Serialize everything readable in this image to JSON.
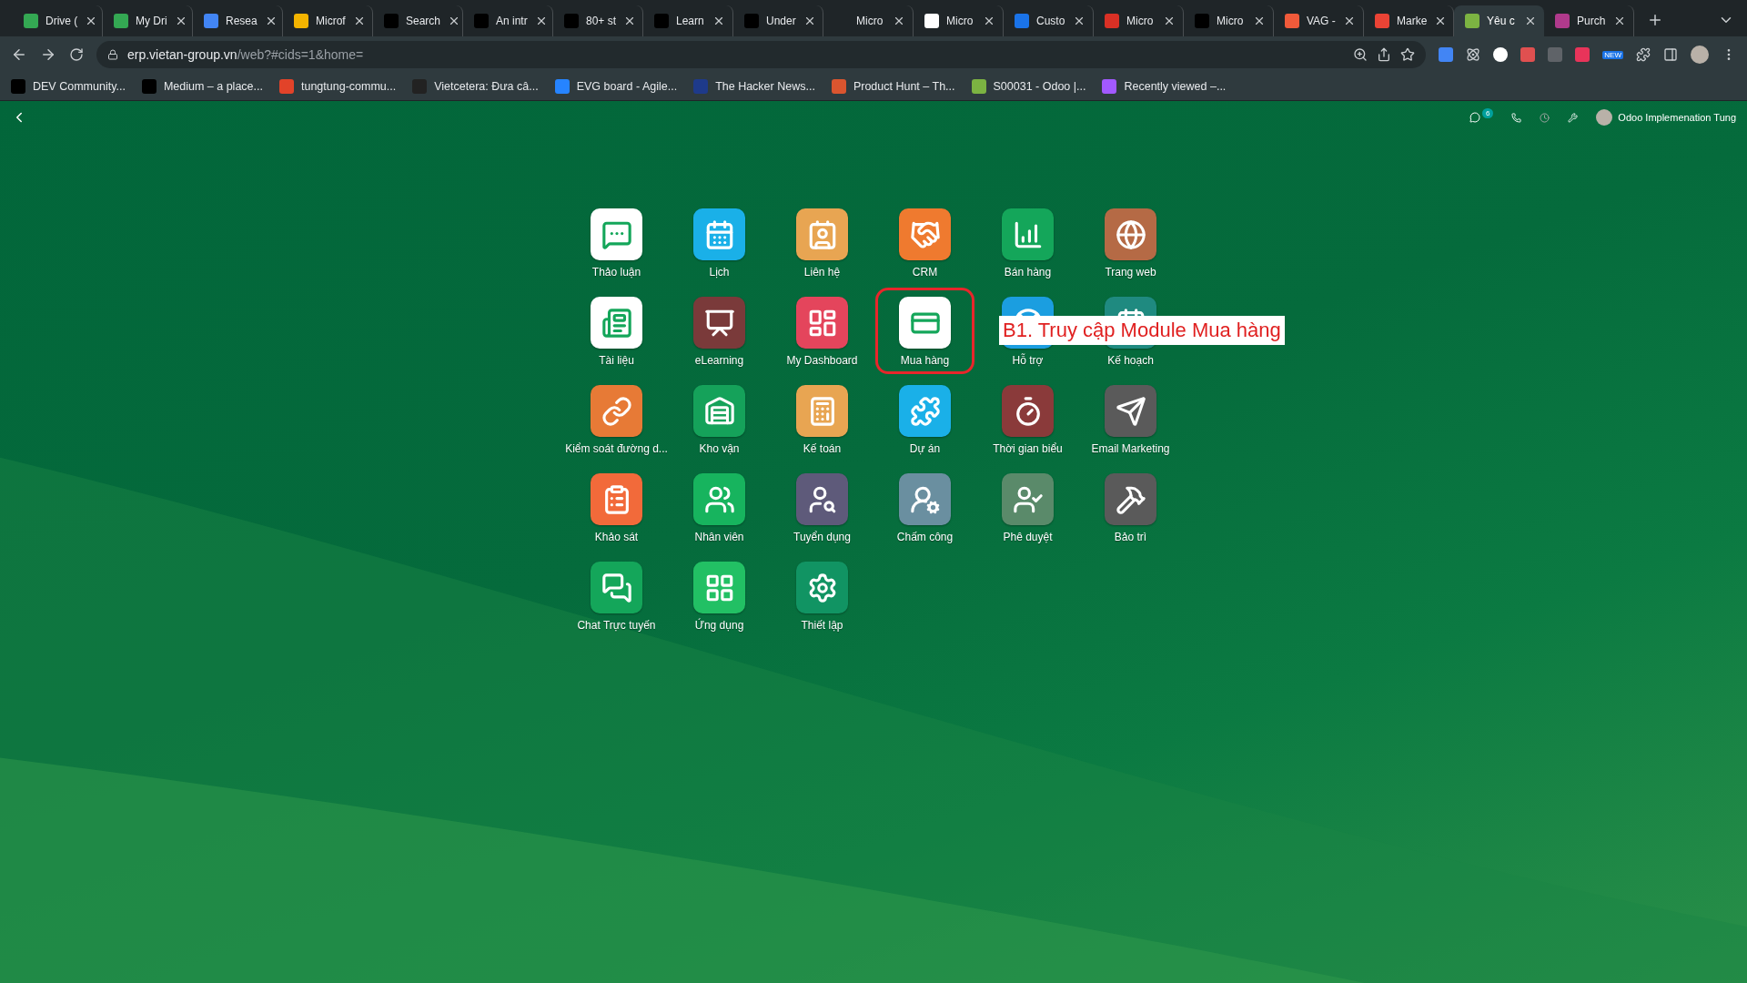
{
  "browser": {
    "tabs": [
      {
        "title": "Drive (",
        "selected": false,
        "color": "#34a853"
      },
      {
        "title": "My Dri",
        "selected": false,
        "color": "#34a853"
      },
      {
        "title": "Resea",
        "selected": false,
        "color": "#4285f4"
      },
      {
        "title": "Microf",
        "selected": false,
        "color": "#f4b400"
      },
      {
        "title": "Search",
        "selected": false,
        "color": "#000000"
      },
      {
        "title": "An intr",
        "selected": false,
        "color": "#000000"
      },
      {
        "title": "80+ st",
        "selected": false,
        "color": "#000000"
      },
      {
        "title": "Learn",
        "selected": false,
        "color": "#000000"
      },
      {
        "title": "Under",
        "selected": false,
        "color": "#000000"
      },
      {
        "title": "Micro",
        "selected": false
      },
      {
        "title": "Micro",
        "selected": false,
        "color": "#ffffff"
      },
      {
        "title": "Custo",
        "selected": false,
        "color": "#1a73e8"
      },
      {
        "title": "Micro",
        "selected": false,
        "color": "#d93025"
      },
      {
        "title": "Micro",
        "selected": false,
        "color": "#000000"
      },
      {
        "title": "VAG -",
        "selected": false,
        "color": "#f05a3a"
      },
      {
        "title": "Marke",
        "selected": false,
        "color": "#ea4335"
      },
      {
        "title": "Yêu c",
        "selected": true,
        "color": "#7cb342"
      },
      {
        "title": "Purch",
        "selected": false,
        "color": "#b03a8c"
      }
    ],
    "url_host": "erp.vietan-group.vn",
    "url_path": "/web?#cids=1&home=",
    "bookmarks": [
      {
        "title": "DEV Community...",
        "color": "#000000"
      },
      {
        "title": "Medium – a place...",
        "color": "#000000"
      },
      {
        "title": "tungtung-commu...",
        "color": "#e24329"
      },
      {
        "title": "Vietcetera: Đưa câ...",
        "color": "#222222"
      },
      {
        "title": "EVG board - Agile...",
        "color": "#2684ff"
      },
      {
        "title": "The Hacker News...",
        "color": "#1e3a8a"
      },
      {
        "title": "Product Hunt – Th...",
        "color": "#da552f"
      },
      {
        "title": "S00031 - Odoo |...",
        "color": "#7cb342"
      },
      {
        "title": "Recently viewed –...",
        "color": "#a259ff"
      }
    ],
    "extension_badge": "NEW"
  },
  "navbar": {
    "message_count": "6",
    "user_name": "Odoo Implemenation Tung"
  },
  "apps": [
    {
      "label": "Thảo luận",
      "color": "#ffffff",
      "highlighted": false
    },
    {
      "label": "Lịch",
      "color": "#1ab0e8",
      "highlighted": false
    },
    {
      "label": "Liên hệ",
      "color": "#e8a552",
      "highlighted": false
    },
    {
      "label": "CRM",
      "color": "#ef7a2f",
      "highlighted": false
    },
    {
      "label": "Bán hàng",
      "color": "#14a65a",
      "highlighted": false
    },
    {
      "label": "Trang web",
      "color": "#b56a45",
      "highlighted": false
    },
    {
      "label": "Tài liệu",
      "color": "#ffffff",
      "highlighted": false
    },
    {
      "label": "eLearning",
      "color": "#7a3a3a",
      "highlighted": false
    },
    {
      "label": "My Dashboard",
      "color": "#e4455c",
      "highlighted": false
    },
    {
      "label": "Mua hàng",
      "color": "#ffffff",
      "highlighted": true
    },
    {
      "label": "Hỗ trợ",
      "color": "#1b9ee0",
      "highlighted": false
    },
    {
      "label": "Kế hoạch",
      "color": "#1f8a80",
      "highlighted": false
    },
    {
      "label": "Kiểm soát đường d...",
      "color": "#e77a36",
      "highlighted": false
    },
    {
      "label": "Kho vận",
      "color": "#15a25a",
      "highlighted": false
    },
    {
      "label": "Kế toán",
      "color": "#e8a552",
      "highlighted": false
    },
    {
      "label": "Dự án",
      "color": "#1ab0e8",
      "highlighted": false
    },
    {
      "label": "Thời gian biểu",
      "color": "#8a3a3a",
      "highlighted": false
    },
    {
      "label": "Email Marketing",
      "color": "#5a5a5a",
      "highlighted": false
    },
    {
      "label": "Khảo sát",
      "color": "#f26a3a",
      "highlighted": false
    },
    {
      "label": "Nhân viên",
      "color": "#17b45e",
      "highlighted": false
    },
    {
      "label": "Tuyển dụng",
      "color": "#5e5a7a",
      "highlighted": false
    },
    {
      "label": "Chấm công",
      "color": "#6a8fa0",
      "highlighted": false
    },
    {
      "label": "Phê duyệt",
      "color": "#5a8a6a",
      "highlighted": false
    },
    {
      "label": "Bảo trì",
      "color": "#5a5a5a",
      "highlighted": false
    },
    {
      "label": "Chat Trực tuyến",
      "color": "#14a65a",
      "highlighted": false
    },
    {
      "label": "Ứng dụng",
      "color": "#22c064",
      "highlighted": false
    },
    {
      "label": "Thiết lập",
      "color": "#119463",
      "highlighted": false
    }
  ],
  "annotation": {
    "text": "B1. Truy cập Module Mua hàng"
  }
}
